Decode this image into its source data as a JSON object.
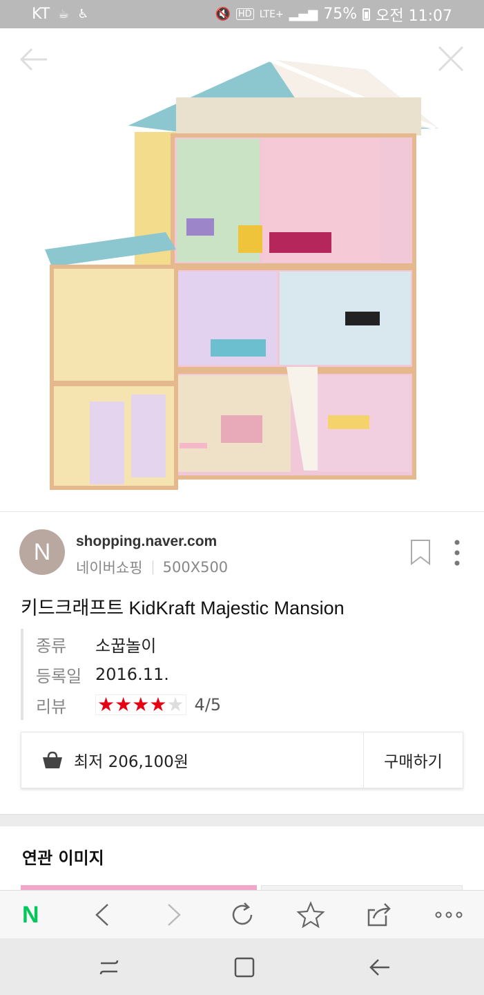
{
  "status_bar": {
    "carrier": "KT",
    "battery": "75%",
    "time": "오전 11:07",
    "network": "LTE+"
  },
  "source": {
    "avatar_letter": "N",
    "domain": "shopping.naver.com",
    "site_name": "네이버쇼핑",
    "image_size": "500X500"
  },
  "product": {
    "title": "키드크래프트 KidKraft Majestic Mansion",
    "details": [
      {
        "key": "종류",
        "value": "소꿉놀이"
      },
      {
        "key": "등록일",
        "value": "2016.11."
      },
      {
        "key": "리뷰",
        "value": "4/5"
      }
    ],
    "rating": 4,
    "rating_max": 5
  },
  "price": {
    "label": "최저 206,100원",
    "buy_label": "구매하기"
  },
  "related": {
    "title": "연관 이미지"
  },
  "browser": {
    "logo": "N"
  },
  "colors": {
    "star": "#e60012",
    "naver_green": "#03c75a"
  }
}
